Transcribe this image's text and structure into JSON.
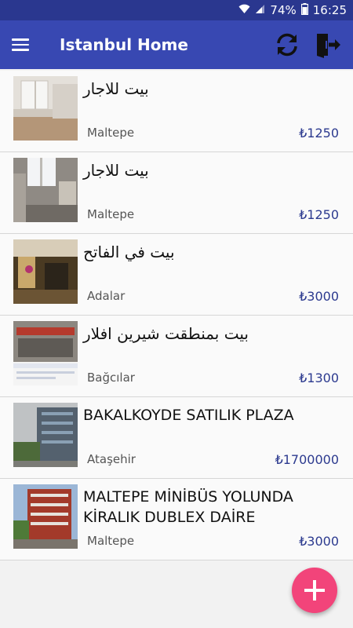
{
  "status_bar": {
    "battery": "74%",
    "time": "16:25",
    "icons": [
      "wifi-icon",
      "signal-icon",
      "battery-icon"
    ]
  },
  "app_bar": {
    "title": "Istanbul Home",
    "icons": [
      "menu-icon",
      "refresh-icon",
      "logout-icon"
    ]
  },
  "listings": [
    {
      "title": "بيت للاجار",
      "location": "Maltepe",
      "price": "₺1250"
    },
    {
      "title": "بيت للاجار",
      "location": "Maltepe",
      "price": "₺1250"
    },
    {
      "title": "بيت في الفاتح",
      "location": "Adalar",
      "price": "₺3000"
    },
    {
      "title": "بيت بمنطقت شيرين افلار",
      "location": "Bağcılar",
      "price": "₺1300"
    },
    {
      "title": "BAKALKOYDE SATILIK PLAZA",
      "location": "Ataşehir",
      "price": "₺1700000"
    },
    {
      "title": "MALTEPE MİNİBÜS YOLUNDA KİRALIK DUBLEX DAİRE",
      "location": "Maltepe",
      "price": "₺3000"
    }
  ],
  "fab": {
    "icon": "plus-icon"
  },
  "colors": {
    "status_bar": "#2a378f",
    "app_bar": "#3848b2",
    "price": "#2c3a8f",
    "fab": "#f2447a"
  }
}
